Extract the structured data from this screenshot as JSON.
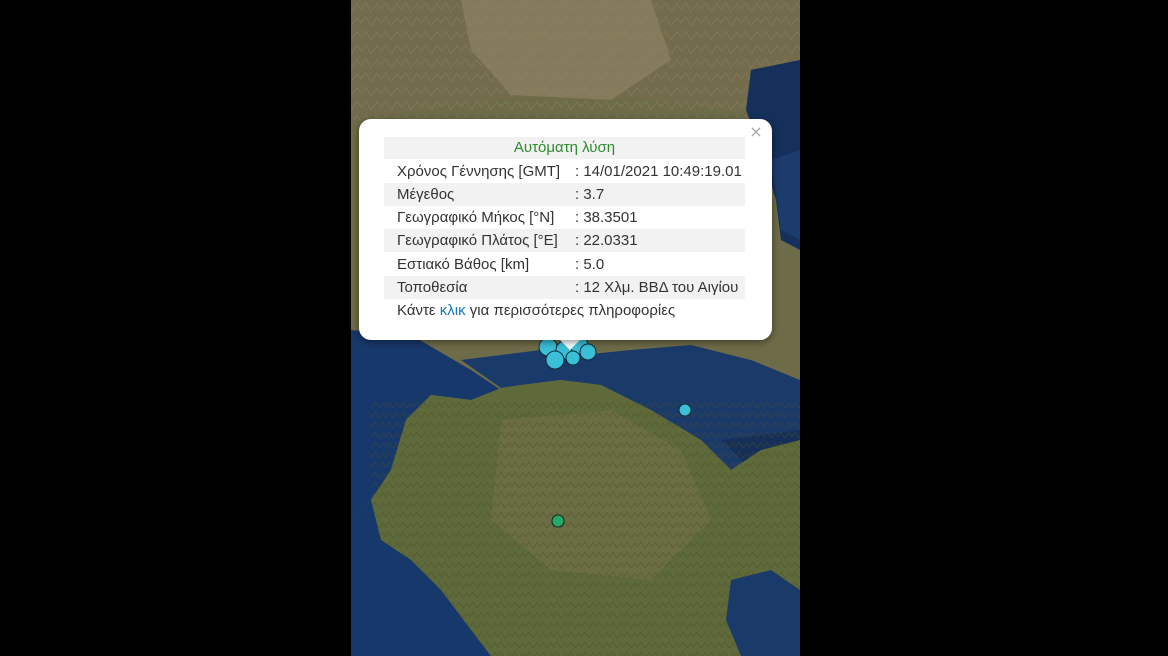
{
  "popup": {
    "title": "Αυτόματη λύση",
    "close_symbol": "×",
    "rows": [
      {
        "label": "Χρόνος Γέννησης [GMT]",
        "value": ": 14/01/2021 10:49:19.01"
      },
      {
        "label": "Μέγεθος",
        "value": ": 3.7"
      },
      {
        "label": "Γεωγραφικό Μήκος [°N]",
        "value": ": 38.3501"
      },
      {
        "label": "Γεωγραφικό Πλάτος [°E]",
        "value": ": 22.0331"
      },
      {
        "label": "Εστιακό Βάθος [km]",
        "value": ": 5.0"
      },
      {
        "label": "Τοποθεσία",
        "value": ": 12 Χλμ. ΒΒΔ του Αιγίου"
      }
    ],
    "more": {
      "prefix": "Κάντε",
      "link": "κλικ",
      "suffix": "για περισσότερες πληροφορίες"
    }
  },
  "colors": {
    "title_green": "#2e8b2e",
    "link_blue": "#1a7bb8",
    "marker_cyan": "#3bbfd6",
    "marker_green": "#2aa86a"
  }
}
